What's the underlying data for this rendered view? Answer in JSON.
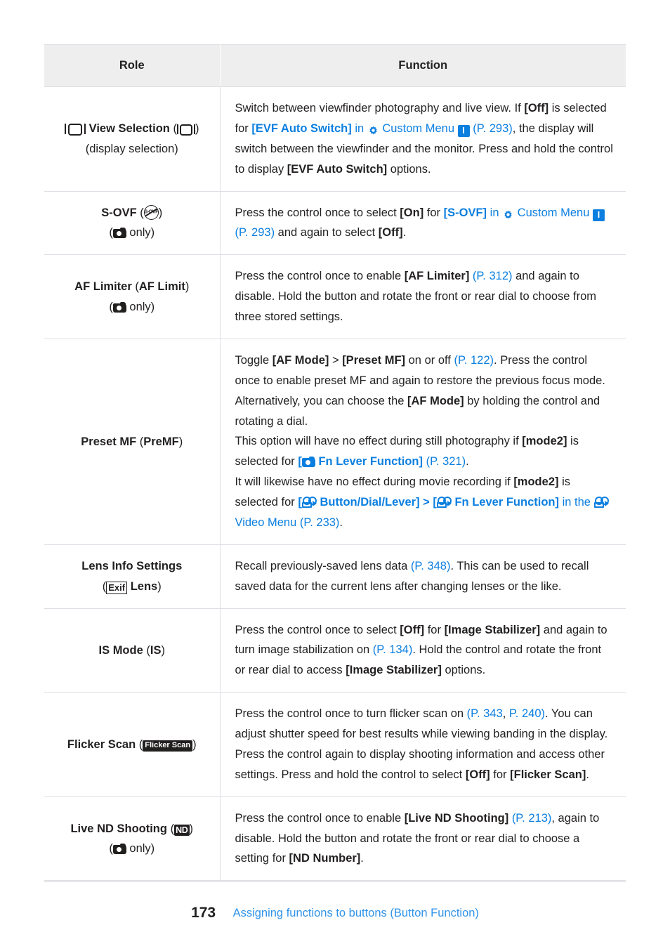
{
  "table": {
    "headers": {
      "role": "Role",
      "function": "Function"
    },
    "rows": [
      {
        "id": "view-selection",
        "role": {
          "name": "View Selection",
          "paren": "",
          "sub": "(display selection)"
        },
        "function_parts": [
          {
            "t": "Switch between viewfinder photography and live view. If ",
            "s": "n"
          },
          {
            "t": "[Off]",
            "s": "b"
          },
          {
            "t": " is selected for ",
            "s": "n"
          },
          {
            "t": "[EVF Auto Switch]",
            "s": "lb"
          },
          {
            "t": " in ",
            "s": "l"
          },
          {
            "t": "gear-icon",
            "s": "icon-gear"
          },
          {
            "t": " Custom Menu ",
            "s": "l"
          },
          {
            "t": "I",
            "s": "badge-i"
          },
          {
            "t": " (P. 293)",
            "s": "l"
          },
          {
            "t": ", the display will switch between the viewfinder and the monitor. Press and hold the control to display ",
            "s": "n"
          },
          {
            "t": "[EVF Auto Switch]",
            "s": "b"
          },
          {
            "t": " options.",
            "s": "n"
          }
        ]
      },
      {
        "id": "s-ovf",
        "role": {
          "name": "S-OVF",
          "paren": "sovf-badge",
          "sub": "camera-only"
        },
        "function_parts": [
          {
            "t": "Press the control once to select ",
            "s": "n"
          },
          {
            "t": "[On]",
            "s": "b"
          },
          {
            "t": " for ",
            "s": "n"
          },
          {
            "t": "[S-OVF]",
            "s": "lb"
          },
          {
            "t": " in ",
            "s": "l"
          },
          {
            "t": "gear-icon",
            "s": "icon-gear"
          },
          {
            "t": " Custom Menu ",
            "s": "l"
          },
          {
            "t": "I",
            "s": "badge-i"
          },
          {
            "t": " (P. 293)",
            "s": "l"
          },
          {
            "t": " and again to select ",
            "s": "n"
          },
          {
            "t": "[Off]",
            "s": "b"
          },
          {
            "t": ".",
            "s": "n"
          }
        ]
      },
      {
        "id": "af-limiter",
        "role": {
          "name": "AF Limiter",
          "paren": "AF Limit",
          "sub": "camera-only"
        },
        "function_parts": [
          {
            "t": "Press the control once to enable ",
            "s": "n"
          },
          {
            "t": "[AF Limiter]",
            "s": "b"
          },
          {
            "t": " ",
            "s": "n"
          },
          {
            "t": "(P. 312)",
            "s": "l"
          },
          {
            "t": " and again to disable. Hold the button and rotate the front or rear dial to choose from three stored settings.",
            "s": "n"
          }
        ]
      },
      {
        "id": "preset-mf",
        "role": {
          "name": "Preset MF",
          "paren": "PreMF",
          "sub": ""
        },
        "function_parts": [
          {
            "t": "Toggle ",
            "s": "n"
          },
          {
            "t": "[AF Mode]",
            "s": "b"
          },
          {
            "t": " > ",
            "s": "n"
          },
          {
            "t": "[Preset MF]",
            "s": "b"
          },
          {
            "t": " on or off ",
            "s": "n"
          },
          {
            "t": "(P. 122)",
            "s": "l"
          },
          {
            "t": ". Press the control once to enable preset MF and again to restore the previous focus mode. Alternatively, you can choose the ",
            "s": "n"
          },
          {
            "t": "[AF Mode]",
            "s": "b"
          },
          {
            "t": " by holding the control and rotating a dial.",
            "s": "n"
          },
          {
            "t": "BREAK",
            "s": "br"
          },
          {
            "t": "This option will have no effect during still photography if ",
            "s": "n"
          },
          {
            "t": "[mode2]",
            "s": "b"
          },
          {
            "t": " is selected for ",
            "s": "n"
          },
          {
            "t": "[",
            "s": "lb"
          },
          {
            "t": "camera-icon",
            "s": "icon-cam-blue"
          },
          {
            "t": " Fn Lever Function]",
            "s": "lb"
          },
          {
            "t": " ",
            "s": "n"
          },
          {
            "t": "(P. 321)",
            "s": "l"
          },
          {
            "t": ".",
            "s": "n"
          },
          {
            "t": "BREAK",
            "s": "br"
          },
          {
            "t": "It will likewise have no effect during movie recording if ",
            "s": "n"
          },
          {
            "t": "[mode2]",
            "s": "b"
          },
          {
            "t": " is selected for ",
            "s": "n"
          },
          {
            "t": "[",
            "s": "lb"
          },
          {
            "t": "movie-icon",
            "s": "icon-mov-blue"
          },
          {
            "t": " Button/Dial/Lever]",
            "s": "lb"
          },
          {
            "t": " > ",
            "s": "lb"
          },
          {
            "t": "[",
            "s": "lb"
          },
          {
            "t": "movie-icon",
            "s": "icon-mov-blue"
          },
          {
            "t": " Fn Lever Function]",
            "s": "lb"
          },
          {
            "t": " in the ",
            "s": "l"
          },
          {
            "t": "movie-icon",
            "s": "icon-mov-blue"
          },
          {
            "t": " Video Menu (P. 233)",
            "s": "l"
          },
          {
            "t": ".",
            "s": "n"
          }
        ]
      },
      {
        "id": "lens-info-settings",
        "role": {
          "name": "Lens Info Settings",
          "paren": "exif-lens",
          "sub": ""
        },
        "function_parts": [
          {
            "t": "Recall previously-saved lens data ",
            "s": "n"
          },
          {
            "t": "(P. 348)",
            "s": "l"
          },
          {
            "t": ". This can be used to recall saved data for the current lens after changing lenses or the like.",
            "s": "n"
          }
        ]
      },
      {
        "id": "is-mode",
        "role": {
          "name": "IS Mode",
          "paren": "IS",
          "sub": ""
        },
        "function_parts": [
          {
            "t": "Press the control once to select ",
            "s": "n"
          },
          {
            "t": "[Off]",
            "s": "b"
          },
          {
            "t": " for ",
            "s": "n"
          },
          {
            "t": "[Image Stabilizer]",
            "s": "b"
          },
          {
            "t": " and again to turn image stabilization on ",
            "s": "n"
          },
          {
            "t": "(P. 134)",
            "s": "l"
          },
          {
            "t": ". Hold the control and rotate the front or rear dial to access ",
            "s": "n"
          },
          {
            "t": "[Image Stabilizer]",
            "s": "b"
          },
          {
            "t": " options.",
            "s": "n"
          }
        ]
      },
      {
        "id": "flicker-scan",
        "role": {
          "name": "Flicker Scan",
          "paren": "flicker-badge",
          "sub": ""
        },
        "function_parts": [
          {
            "t": "Press the control once to turn flicker scan on ",
            "s": "n"
          },
          {
            "t": "(P. 343",
            "s": "l"
          },
          {
            "t": ", ",
            "s": "n"
          },
          {
            "t": "P. 240)",
            "s": "l"
          },
          {
            "t": ". You can adjust shutter speed for best results while viewing banding in the display. Press the control again to display shooting information and access other settings. Press and hold the control to select ",
            "s": "n"
          },
          {
            "t": "[Off]",
            "s": "b"
          },
          {
            "t": " for ",
            "s": "n"
          },
          {
            "t": "[Flicker Scan]",
            "s": "b"
          },
          {
            "t": ".",
            "s": "n"
          }
        ]
      },
      {
        "id": "live-nd-shooting",
        "role": {
          "name": "Live ND Shooting",
          "paren": "nd-badge",
          "sub": "camera-only"
        },
        "function_parts": [
          {
            "t": "Press the control once to enable ",
            "s": "n"
          },
          {
            "t": "[Live ND Shooting]",
            "s": "b"
          },
          {
            "t": " ",
            "s": "n"
          },
          {
            "t": "(P. 213)",
            "s": "l"
          },
          {
            "t": ", again to disable. Hold the button and rotate the front or rear dial to choose a setting for ",
            "s": "n"
          },
          {
            "t": "[ND Number]",
            "s": "b"
          },
          {
            "t": ".",
            "s": "n"
          }
        ]
      }
    ]
  },
  "labels": {
    "only_suffix": "only)",
    "only_prefix": "(",
    "sovf_badge_text": "S-OVF",
    "exif_badge_text": "Exif",
    "exif_lens_text": "Lens",
    "flicker_badge_text": "Flicker Scan",
    "nd_badge_text": "ND",
    "display_selection": "(display selection)"
  },
  "footer": {
    "page_number": "173",
    "title": "Assigning functions to buttons (Button Function)"
  },
  "colors": {
    "link": "#0b7fe0",
    "page_ref": "#2f93e8",
    "text": "#221f1f",
    "header_bg": "#eeeeee",
    "border": "#dcdfe4"
  }
}
